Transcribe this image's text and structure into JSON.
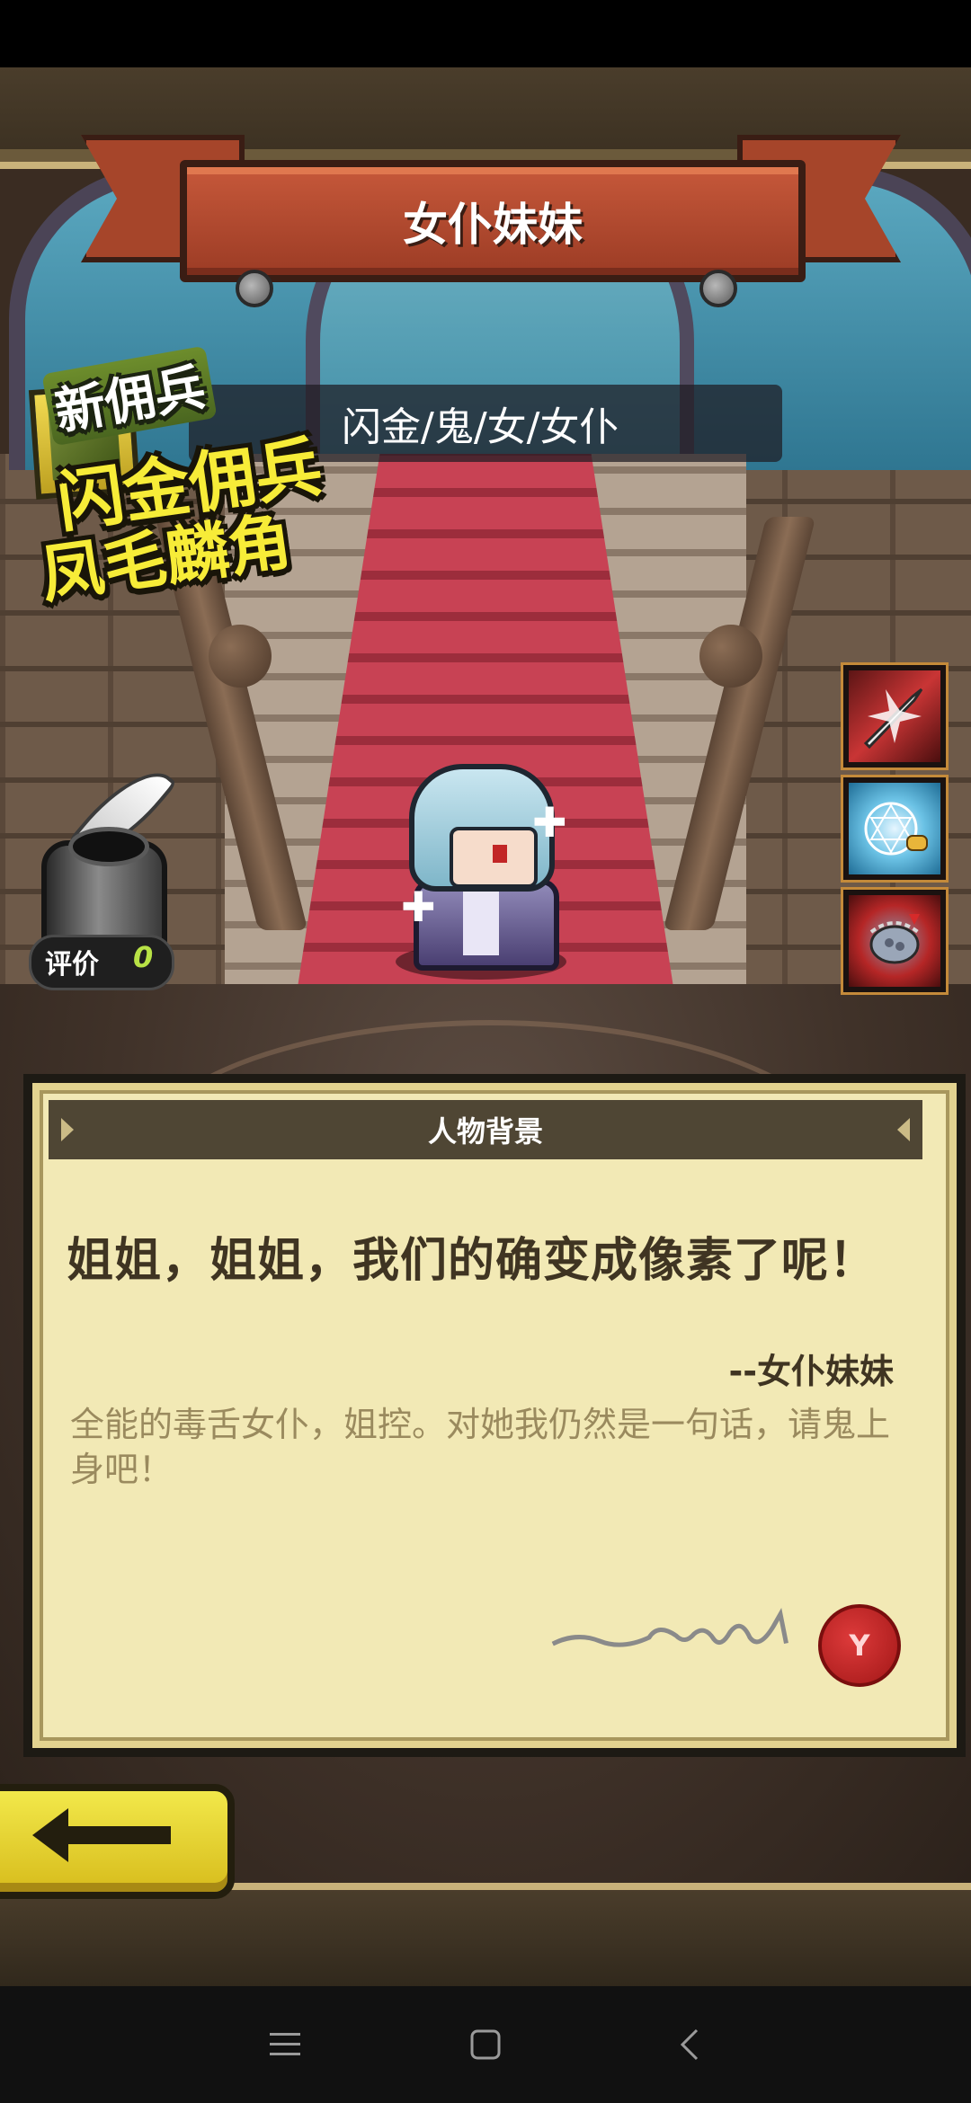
{
  "hero": {
    "name": "女仆妹妹",
    "tags": "闪金/鬼/女/女仆"
  },
  "promo": {
    "badge": "新佣兵",
    "line1": "闪金佣兵",
    "line2": "凤毛麟角"
  },
  "rating": {
    "label": "评价",
    "value": "0"
  },
  "skills": [
    {
      "icon": "sword-slash-icon"
    },
    {
      "icon": "magic-circle-handshake-icon"
    },
    {
      "icon": "chain-shield-icon"
    }
  ],
  "background_panel": {
    "title": "人物背景",
    "quote": "姐姐，姐姐，我们的确变成像素了呢！",
    "author": "--女仆妹妹",
    "description": "全能的毒舌女仆，姐控。对她我仍然是一句话，请鬼上身吧！"
  },
  "buttons": {
    "back": "back-arrow-icon"
  },
  "nav": {
    "menu": "menu-icon",
    "home": "home-square-icon",
    "back": "back-chevron-icon"
  },
  "colors": {
    "banner": "#a6452a",
    "parchment": "#f2e9b5",
    "promo_yellow": "#f7ec38",
    "back_button": "#e8d534"
  }
}
